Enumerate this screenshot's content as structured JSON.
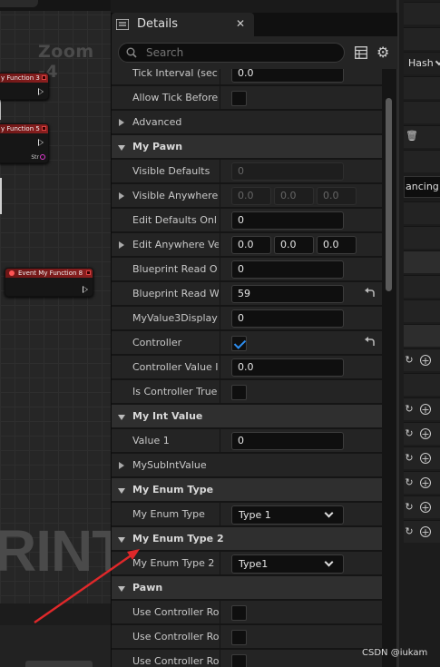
{
  "graph": {
    "zoom_label": "Zoom -4",
    "watermark": "RINT",
    "nodes": {
      "n1": "y Function 3",
      "n2": "y Function 5",
      "n2_pin": "Str",
      "n3": "Event My Function 8"
    }
  },
  "right_panel": {
    "hash_label": "Hash",
    "ancing_label": "ancing"
  },
  "details": {
    "tab_title": "Details",
    "search_placeholder": "Search",
    "rows": [
      {
        "kind": "prop",
        "name": "Tick Interval (sec",
        "value": "0.0",
        "type": "text"
      },
      {
        "kind": "prop",
        "name": "Allow Tick Before",
        "type": "check",
        "checked": false
      },
      {
        "kind": "group",
        "name": "Advanced"
      },
      {
        "kind": "cat",
        "name": "My Pawn"
      },
      {
        "kind": "prop",
        "name": "Visible Defaults",
        "value": "0",
        "type": "disabled"
      },
      {
        "kind": "prop",
        "name": "Visible Anywhere",
        "type": "vec-disabled",
        "values": [
          "0.0",
          "0.0",
          "0.0"
        ],
        "expander": true
      },
      {
        "kind": "prop",
        "name": "Edit Defaults Onl",
        "value": "0",
        "type": "text"
      },
      {
        "kind": "prop",
        "name": "Edit Anywhere Ve",
        "type": "vec",
        "values": [
          "0.0",
          "0.0",
          "0.0"
        ],
        "expander": true
      },
      {
        "kind": "prop",
        "name": "Blueprint Read O",
        "value": "0",
        "type": "text"
      },
      {
        "kind": "prop",
        "name": "Blueprint Read W",
        "value": "59",
        "type": "text",
        "reset": true
      },
      {
        "kind": "prop",
        "name": "MyValue3Display",
        "value": "0",
        "type": "text"
      },
      {
        "kind": "prop",
        "name": "Controller",
        "type": "check",
        "checked": true,
        "reset": true
      },
      {
        "kind": "prop",
        "name": "Controller Value I",
        "value": "0.0",
        "type": "text"
      },
      {
        "kind": "prop",
        "name": "Is Controller True",
        "type": "check",
        "checked": false
      },
      {
        "kind": "cat",
        "name": "My Int Value"
      },
      {
        "kind": "prop",
        "name": "Value 1",
        "value": "0",
        "type": "text"
      },
      {
        "kind": "group",
        "name": "MySubIntValue"
      },
      {
        "kind": "cat",
        "name": "My Enum Type"
      },
      {
        "kind": "prop",
        "name": "My Enum Type",
        "value": "Type 1",
        "type": "combo"
      },
      {
        "kind": "cat",
        "name": "My Enum Type 2"
      },
      {
        "kind": "prop",
        "name": "My Enum Type 2",
        "value": "Type1",
        "type": "combo"
      },
      {
        "kind": "cat",
        "name": "Pawn"
      },
      {
        "kind": "prop",
        "name": "Use Controller Ro",
        "type": "check",
        "checked": false
      },
      {
        "kind": "prop",
        "name": "Use Controller Ro",
        "type": "check",
        "checked": false
      },
      {
        "kind": "prop",
        "name": "Use Controller Ro",
        "type": "check",
        "checked": false
      }
    ]
  },
  "annotation": {
    "arrow_color": "#e0282a"
  },
  "footer": {
    "credit": "CSDN @iukam"
  }
}
